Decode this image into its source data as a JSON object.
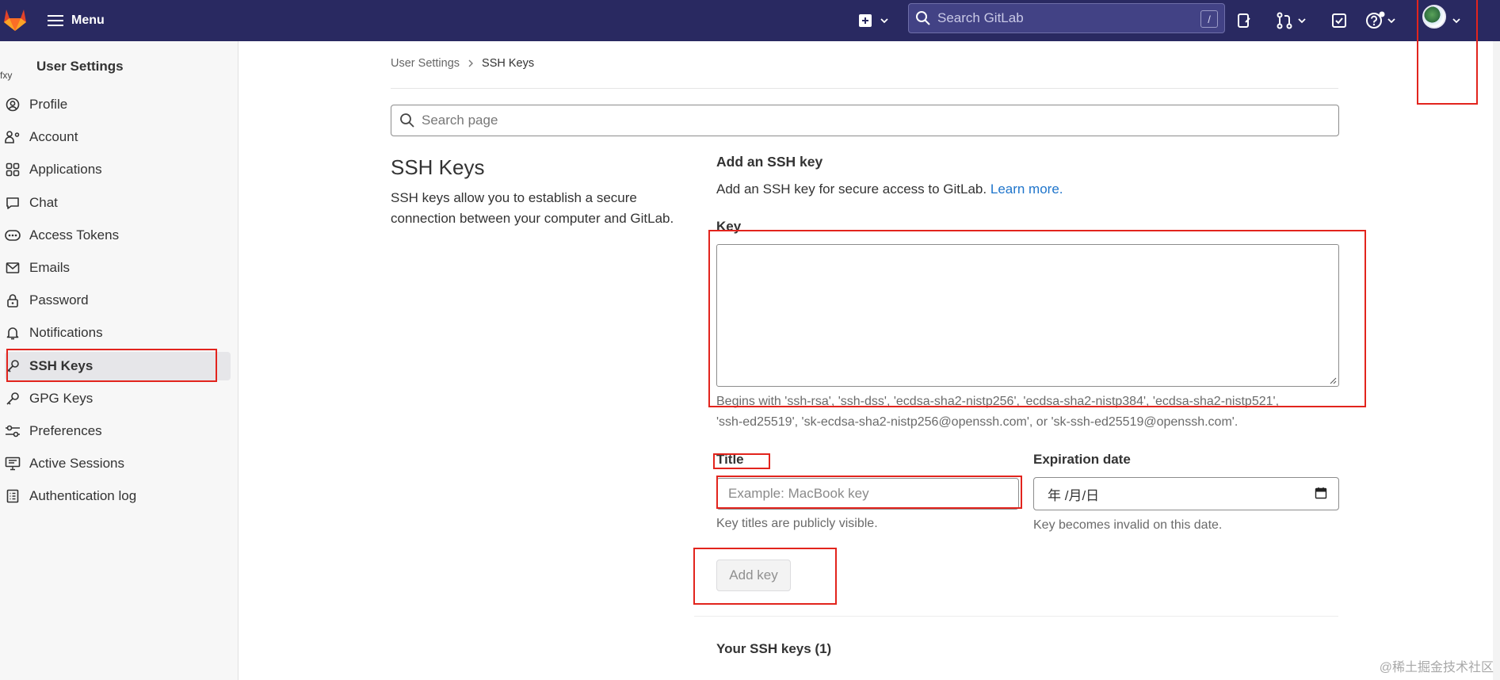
{
  "topbar": {
    "menu_label": "Menu",
    "search_placeholder": "Search GitLab",
    "search_shortcut": "/"
  },
  "sidebar": {
    "title": "User Settings",
    "avatar_alt": "fxy",
    "items": [
      {
        "label": "Profile",
        "icon": "profile-icon"
      },
      {
        "label": "Account",
        "icon": "account-icon"
      },
      {
        "label": "Applications",
        "icon": "applications-icon"
      },
      {
        "label": "Chat",
        "icon": "chat-icon"
      },
      {
        "label": "Access Tokens",
        "icon": "token-icon"
      },
      {
        "label": "Emails",
        "icon": "mail-icon"
      },
      {
        "label": "Password",
        "icon": "lock-icon"
      },
      {
        "label": "Notifications",
        "icon": "bell-icon"
      },
      {
        "label": "SSH Keys",
        "icon": "key-icon",
        "active": true
      },
      {
        "label": "GPG Keys",
        "icon": "key-icon"
      },
      {
        "label": "Preferences",
        "icon": "preferences-icon"
      },
      {
        "label": "Active Sessions",
        "icon": "monitor-icon"
      },
      {
        "label": "Authentication log",
        "icon": "log-icon"
      }
    ]
  },
  "breadcrumb": {
    "parent": "User Settings",
    "current": "SSH Keys"
  },
  "page_search_placeholder": "Search page",
  "section": {
    "title": "SSH Keys",
    "description": "SSH keys allow you to establish a secure connection between your computer and GitLab."
  },
  "form": {
    "heading": "Add an SSH key",
    "intro": "Add an SSH key for secure access to GitLab.",
    "learn_more": "Learn more.",
    "key_label": "Key",
    "key_help_line1": "Begins with 'ssh-rsa', 'ssh-dss', 'ecdsa-sha2-nistp256', 'ecdsa-sha2-nistp384', 'ecdsa-sha2-nistp521',",
    "key_help_line2": "'ssh-ed25519', 'sk-ecdsa-sha2-nistp256@openssh.com', or 'sk-ssh-ed25519@openssh.com'.",
    "title_label": "Title",
    "title_placeholder": "Example: MacBook key",
    "title_help": "Key titles are publicly visible.",
    "expiration_label": "Expiration date",
    "expiration_value": "年 /月/日",
    "expiration_help": "Key becomes invalid on this date.",
    "add_button": "Add key"
  },
  "your_keys_heading": "Your SSH keys (1)",
  "watermark": "@稀土掘金技术社区",
  "colors": {
    "topbar": "#292961",
    "annotation": "#e2241d",
    "link": "#1f75cb"
  }
}
